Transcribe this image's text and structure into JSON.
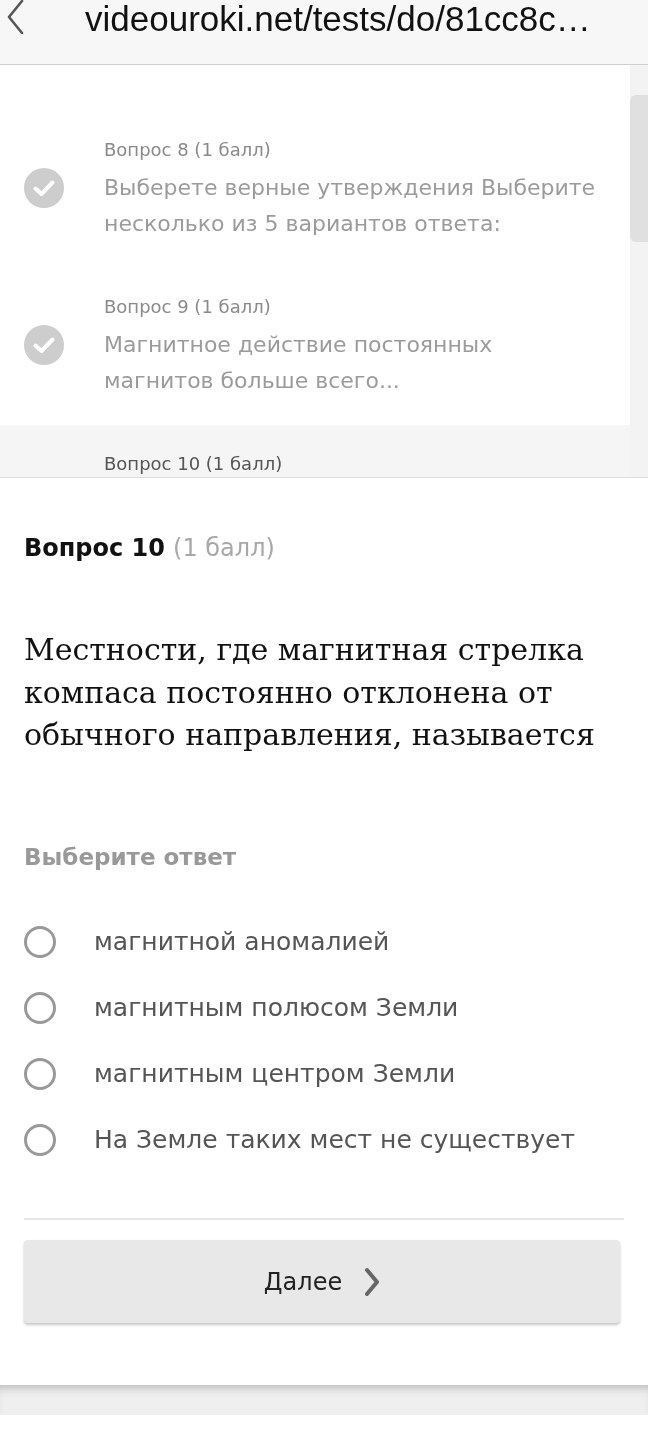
{
  "browser": {
    "url": "videouroki.net/tests/do/81cc8c…"
  },
  "question_list": {
    "items": [
      {
        "label": "Вопрос 8 (1 балл)",
        "text": "Выберете верные утверждения Выберите несколько из 5 вариантов ответа:",
        "answered": true,
        "current": false
      },
      {
        "label": "Вопрос 9 (1 балл)",
        "text": "Магнитное действие постоянных магнитов больше всего...",
        "answered": true,
        "current": false
      },
      {
        "label": "Вопрос 10 (1 балл)",
        "current": true
      }
    ]
  },
  "question": {
    "title": "Вопрос 10",
    "points": "(1 балл)",
    "text": "Местности, где магнитная стрелка компаса постоянно отклонена от обычного направления, называется",
    "prompt": "Выберите ответ",
    "options": [
      {
        "label": "магнитной аномалией",
        "selected": false
      },
      {
        "label": "магнитным полюсом Земли",
        "selected": false
      },
      {
        "label": "магнитным центром Земли",
        "selected": false
      },
      {
        "label": "На Земле таких мест не существует",
        "selected": false
      }
    ]
  },
  "next_button": {
    "label": "Далее"
  }
}
